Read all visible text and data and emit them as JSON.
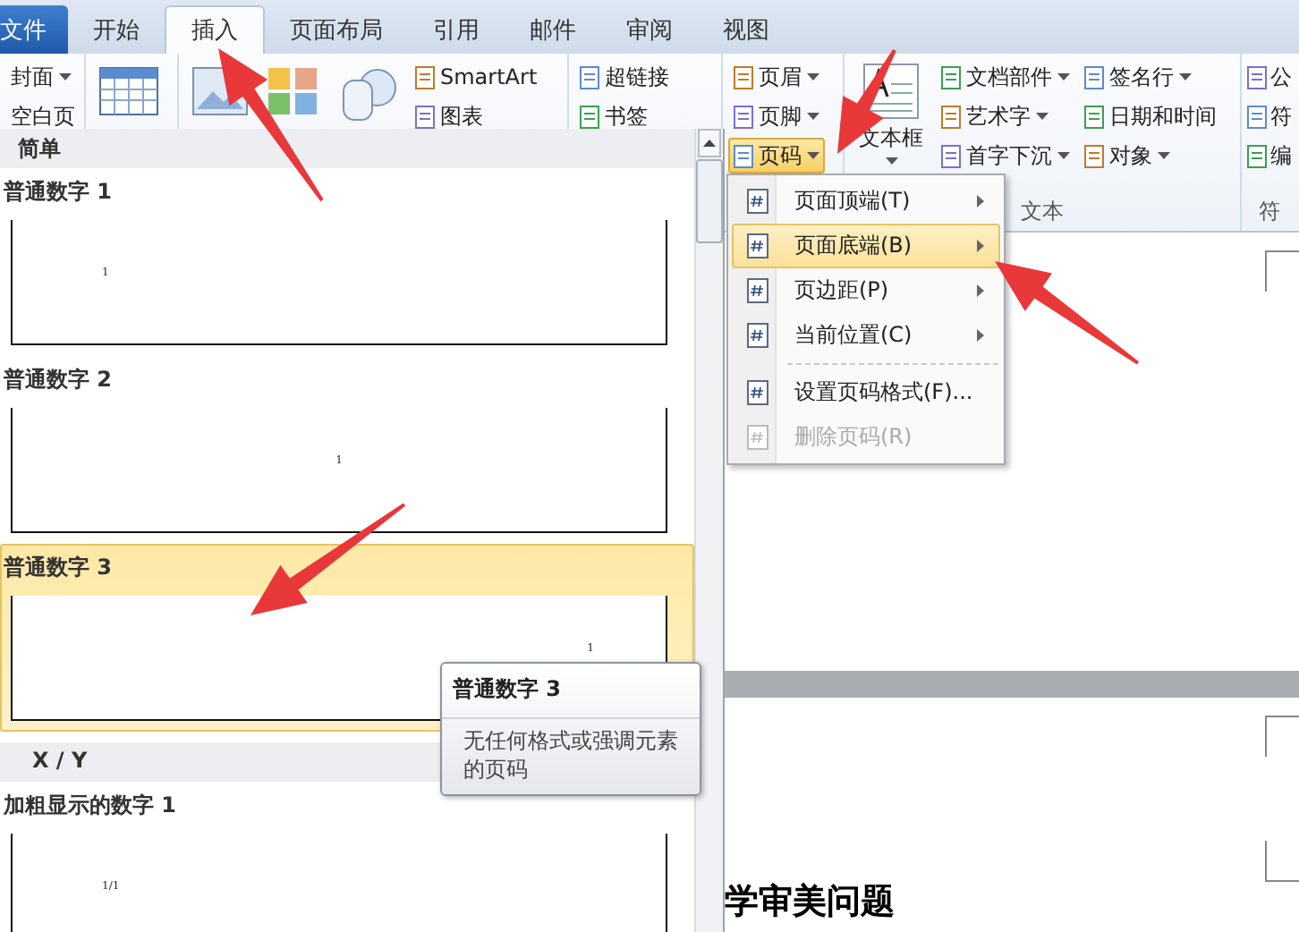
{
  "ribbon_tabs": [
    {
      "label": "文件",
      "kind": "file",
      "selected": false
    },
    {
      "label": "开始",
      "kind": "tab",
      "selected": false
    },
    {
      "label": "插入",
      "kind": "tab",
      "selected": true
    },
    {
      "label": "页面布局",
      "kind": "tab",
      "selected": false
    },
    {
      "label": "引用",
      "kind": "tab",
      "selected": false
    },
    {
      "label": "邮件",
      "kind": "tab",
      "selected": false
    },
    {
      "label": "审阅",
      "kind": "tab",
      "selected": false
    },
    {
      "label": "视图",
      "kind": "tab",
      "selected": false
    }
  ],
  "ribbon_groups": [
    {
      "columns": [
        {
          "kind": "stack",
          "items": [
            {
              "label": "封面",
              "dropdown": true,
              "open": false
            },
            {
              "label": "空白页",
              "dropdown": false,
              "open": false
            }
          ]
        }
      ]
    },
    {
      "columns": [
        {
          "kind": "icon"
        }
      ]
    },
    {
      "columns": [
        {
          "kind": "icon"
        },
        {
          "kind": "icon"
        },
        {
          "kind": "icon"
        },
        {
          "kind": "stack",
          "items": [
            {
              "label": "SmartArt",
              "dropdown": false,
              "open": false
            },
            {
              "label": "图表",
              "dropdown": false,
              "open": false
            }
          ]
        }
      ]
    },
    {
      "columns": [
        {
          "kind": "stack",
          "items": [
            {
              "label": "超链接",
              "dropdown": false,
              "open": false
            },
            {
              "label": "书签",
              "dropdown": false,
              "open": false
            }
          ]
        }
      ]
    },
    {
      "columns": [
        {
          "kind": "stack",
          "items": [
            {
              "label": "页眉",
              "dropdown": true,
              "open": false
            },
            {
              "label": "页脚",
              "dropdown": true,
              "open": false
            },
            {
              "label": "页码",
              "dropdown": true,
              "open": true
            }
          ]
        }
      ]
    },
    {
      "label": "文本",
      "columns": [
        {
          "kind": "large",
          "label": "文本框",
          "dropdown": true
        },
        {
          "kind": "stack",
          "items": [
            {
              "label": "文档部件",
              "dropdown": true,
              "open": false
            },
            {
              "label": "艺术字",
              "dropdown": true,
              "open": false
            },
            {
              "label": "首字下沉",
              "dropdown": true,
              "open": false
            }
          ]
        },
        {
          "kind": "stack",
          "items": [
            {
              "label": "签名行",
              "dropdown": true,
              "open": false
            },
            {
              "label": "日期和时间",
              "dropdown": false,
              "open": false
            },
            {
              "label": "对象",
              "dropdown": true,
              "open": false
            }
          ]
        }
      ]
    },
    {
      "label": "符",
      "columns": [
        {
          "kind": "stack",
          "items": [
            {
              "label": "公",
              "dropdown": false,
              "open": false
            },
            {
              "label": "符",
              "dropdown": false,
              "open": false
            },
            {
              "label": "编",
              "dropdown": false,
              "open": false
            }
          ]
        }
      ]
    }
  ],
  "gallery": {
    "sections": [
      {
        "heading": "简单",
        "items": [
          {
            "label": "普通数字 1",
            "number": "1",
            "kind": "left",
            "selected": false
          },
          {
            "label": "普通数字 2",
            "number": "1",
            "kind": "center",
            "selected": false
          },
          {
            "label": "普通数字 3",
            "number": "1",
            "kind": "right",
            "selected": true
          }
        ]
      },
      {
        "heading": "X / Y",
        "items": [
          {
            "label": "加粗显示的数字 1",
            "number": "1/1",
            "kind": "left",
            "selected": false
          }
        ]
      }
    ]
  },
  "page_number_menu": [
    {
      "label": "页面顶端(T)",
      "submenu": true,
      "selected": false,
      "disabled": false,
      "separator_before": false
    },
    {
      "label": "页面底端(B)",
      "submenu": true,
      "selected": true,
      "disabled": false,
      "separator_before": false
    },
    {
      "label": "页边距(P)",
      "submenu": true,
      "selected": false,
      "disabled": false,
      "separator_before": false
    },
    {
      "label": "当前位置(C)",
      "submenu": true,
      "selected": false,
      "disabled": false,
      "separator_before": false
    },
    {
      "label": "设置页码格式(F)...",
      "submenu": false,
      "selected": false,
      "disabled": false,
      "separator_before": true
    },
    {
      "label": "删除页码(R)",
      "submenu": false,
      "selected": false,
      "disabled": true,
      "separator_before": false
    }
  ],
  "tooltip": {
    "title": "普通数字 3",
    "description": "无任何格式或强调元素的页码"
  },
  "document": {
    "title": "学审美问题"
  }
}
